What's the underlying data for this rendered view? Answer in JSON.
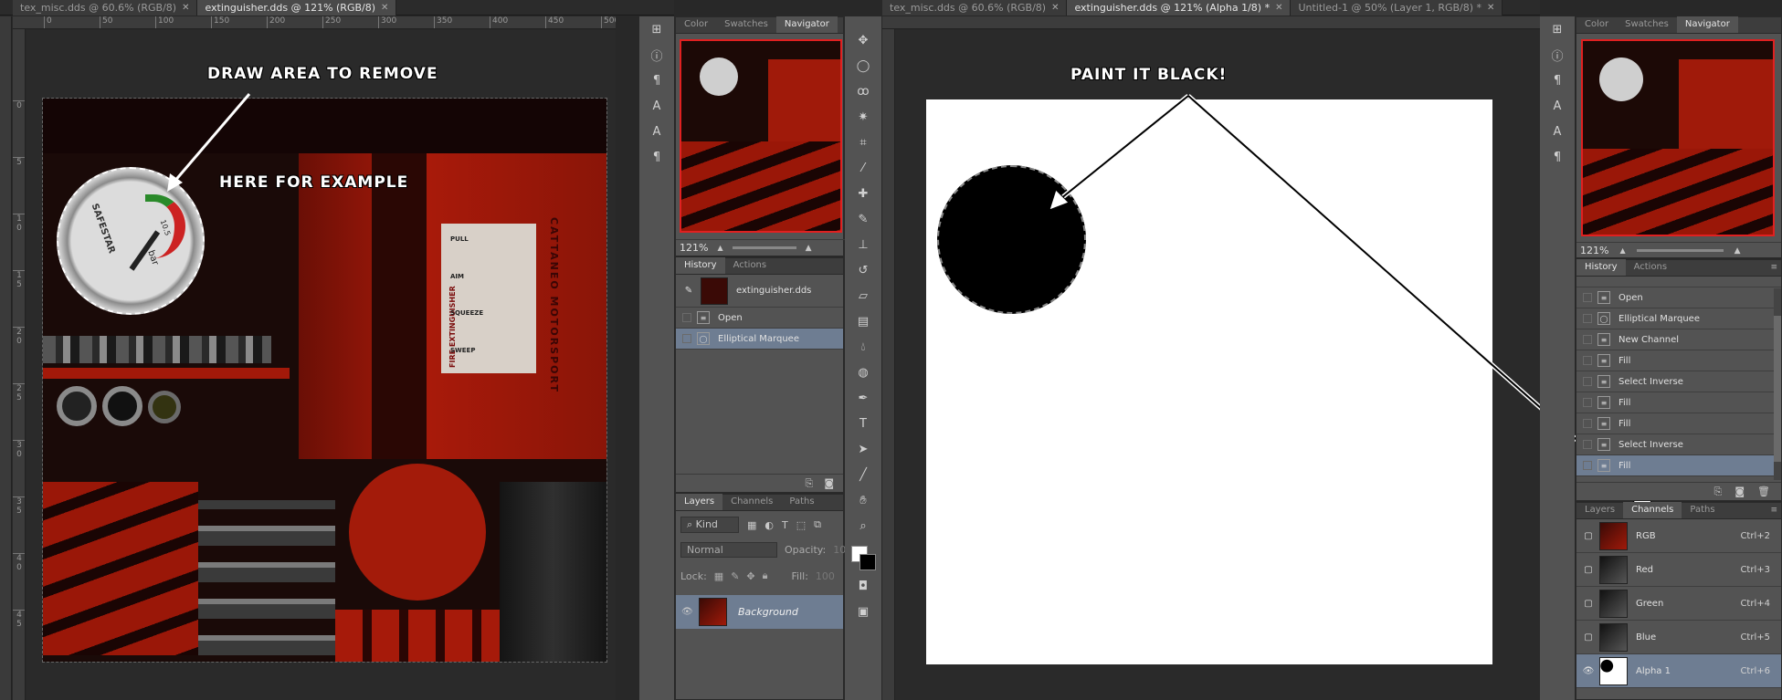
{
  "left_window": {
    "tabs": [
      {
        "label": "tex_misc.dds @ 60.6% (RGB/8)",
        "active": false
      },
      {
        "label": "extinguisher.dds @ 121% (RGB/8)",
        "active": true
      }
    ],
    "ruler_h": [
      "0",
      "50",
      "100",
      "150",
      "200",
      "250",
      "300",
      "350",
      "400",
      "450",
      "500"
    ],
    "ruler_v": [
      "0",
      "5",
      "1 0",
      "1 5",
      "2 0",
      "2 5",
      "3 0",
      "3 5",
      "4 0",
      "4 5"
    ],
    "annotations": {
      "draw_area": "DRAW AREA TO REMOVE",
      "here_example": "HERE FOR EXAMPLE"
    },
    "texture_text": {
      "gauge_brand": "SAFESTAR",
      "gauge_unit": "bar",
      "gauge_values": [
        "10.5",
        "18",
        "12"
      ],
      "label_title": "FIRE EXTINGUISHER",
      "label_steps": [
        "PULL",
        "AIM",
        "SQUEEZE",
        "SWEEP"
      ],
      "side_text": "CATTANEO MOTORSPORT"
    }
  },
  "left_panels": {
    "color_group_tabs": [
      {
        "label": "Color",
        "active": false
      },
      {
        "label": "Swatches",
        "active": false
      },
      {
        "label": "Navigator",
        "active": true
      }
    ],
    "zoom": "121%",
    "history_tabs": [
      {
        "label": "History",
        "active": true
      },
      {
        "label": "Actions",
        "active": false
      }
    ],
    "history_snapshot": "extinguisher.dds",
    "history_items": [
      {
        "label": "Open",
        "selected": false
      },
      {
        "label": "Elliptical Marquee",
        "selected": true
      }
    ],
    "layers_tabs": [
      {
        "label": "Layers",
        "active": true
      },
      {
        "label": "Channels",
        "active": false
      },
      {
        "label": "Paths",
        "active": false
      }
    ],
    "filter_kind": "Kind",
    "blend_mode": "Normal",
    "opacity_label": "Opacity:",
    "opacity_value": "100",
    "lock_label": "Lock:",
    "fill_label": "Fill:",
    "fill_value": "100",
    "layer_name": "Background"
  },
  "right_window": {
    "tabs": [
      {
        "label": "tex_misc.dds @ 60.6% (RGB/8)",
        "active": false
      },
      {
        "label": "extinguisher.dds @ 121% (Alpha 1/8) *",
        "active": true
      },
      {
        "label": "Untitled-1 @ 50% (Layer 1, RGB/8) *",
        "active": false
      }
    ],
    "annotation": "PAINT IT BLACK!"
  },
  "right_panels": {
    "color_group_tabs": [
      {
        "label": "Color",
        "active": false
      },
      {
        "label": "Swatches",
        "active": false
      },
      {
        "label": "Navigator",
        "active": true
      }
    ],
    "zoom": "121%",
    "history_tabs": [
      {
        "label": "History",
        "active": true
      },
      {
        "label": "Actions",
        "active": false
      }
    ],
    "history_items": [
      {
        "label": "Open",
        "selected": false
      },
      {
        "label": "Elliptical Marquee",
        "selected": false
      },
      {
        "label": "New Channel",
        "selected": false
      },
      {
        "label": "Fill",
        "selected": false
      },
      {
        "label": "Select Inverse",
        "selected": false
      },
      {
        "label": "Fill",
        "selected": false
      },
      {
        "label": "Fill",
        "selected": false
      },
      {
        "label": "Select Inverse",
        "selected": false
      },
      {
        "label": "Fill",
        "selected": true
      }
    ],
    "channels_tabs": [
      {
        "label": "Layers",
        "active": false
      },
      {
        "label": "Channels",
        "active": true
      },
      {
        "label": "Paths",
        "active": false
      }
    ],
    "channels": [
      {
        "name": "RGB",
        "shortcut": "Ctrl+2",
        "selected": false,
        "visible": false
      },
      {
        "name": "Red",
        "shortcut": "Ctrl+3",
        "selected": false,
        "visible": false
      },
      {
        "name": "Green",
        "shortcut": "Ctrl+4",
        "selected": false,
        "visible": false
      },
      {
        "name": "Blue",
        "shortcut": "Ctrl+5",
        "selected": false,
        "visible": false
      },
      {
        "name": "Alpha 1",
        "shortcut": "Ctrl+6",
        "selected": true,
        "visible": true
      }
    ]
  },
  "colors": {
    "workspace": "#282828",
    "panel": "#535353",
    "selection": "#6e7d92",
    "navigator_frame": "#e02020",
    "texture_red": "#b01b0b"
  }
}
